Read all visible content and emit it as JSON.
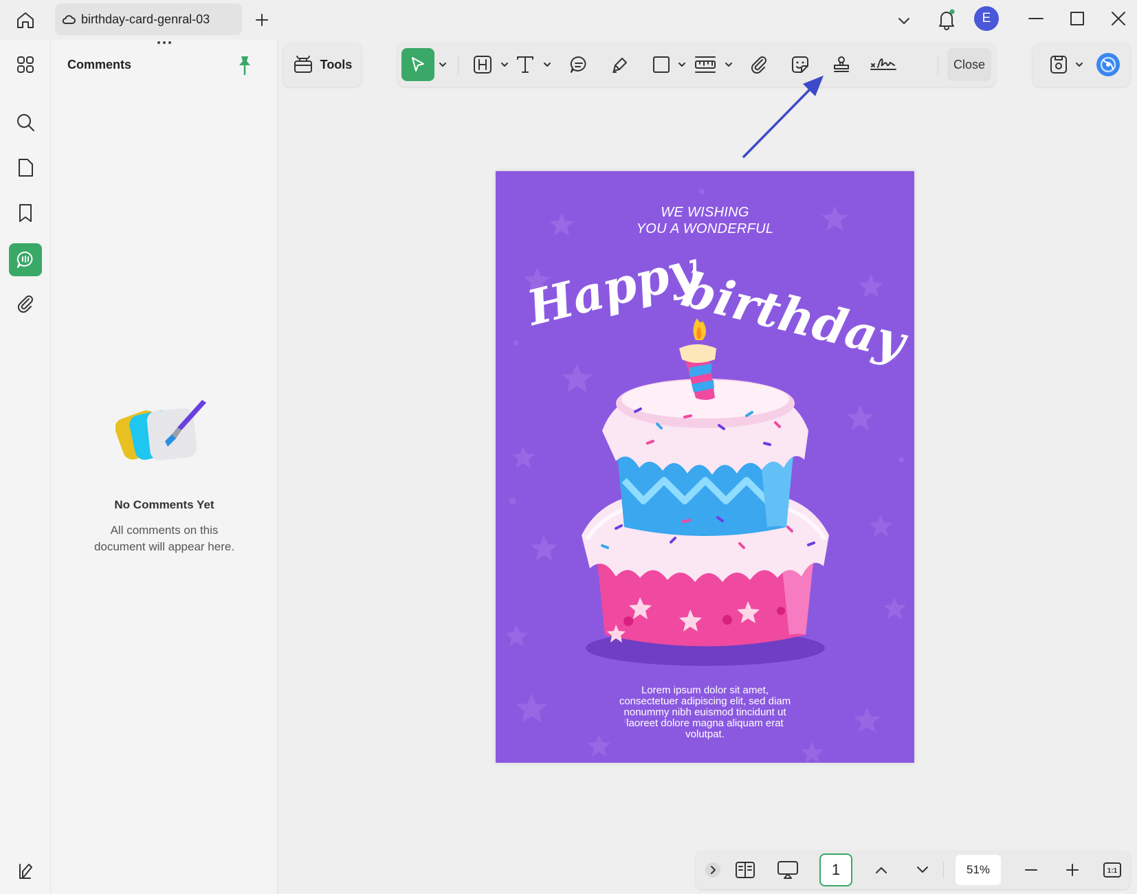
{
  "tab": {
    "title": "birthday-card-genral-03"
  },
  "user": {
    "avatar_initial": "E"
  },
  "comments_panel": {
    "title": "Comments",
    "empty_title": "No Comments Yet",
    "empty_desc_line1": "All comments on this",
    "empty_desc_line2": "document will appear here."
  },
  "toolbar": {
    "tools_label": "Tools",
    "close_label": "Close",
    "icons": [
      "select",
      "highlight",
      "text",
      "comment",
      "pencil",
      "rectangle",
      "measure",
      "attachment",
      "sticker",
      "stamp",
      "signature"
    ]
  },
  "card": {
    "subtitle_line1": "WE WISHING",
    "subtitle_line2": "YOU A WONDERFUL",
    "headline_word1": "Happy",
    "headline_word2": "birthday",
    "body_line1": "Lorem ipsum dolor sit amet,",
    "body_line2": "consectetuer adipiscing elit, sed diam",
    "body_line3": "nonummy nibh euismod tincidunt ut",
    "body_line4": "laoreet dolore magna aliquam erat",
    "body_line5": "volutpat."
  },
  "navigation": {
    "current_page": "1",
    "zoom": "51%",
    "fit_label": "1:1"
  },
  "colors": {
    "accent_green": "#3aa867",
    "card_purple": "#8b59e0",
    "avatar_blue": "#4a57d8",
    "annotation_arrow": "#3d49c9"
  }
}
